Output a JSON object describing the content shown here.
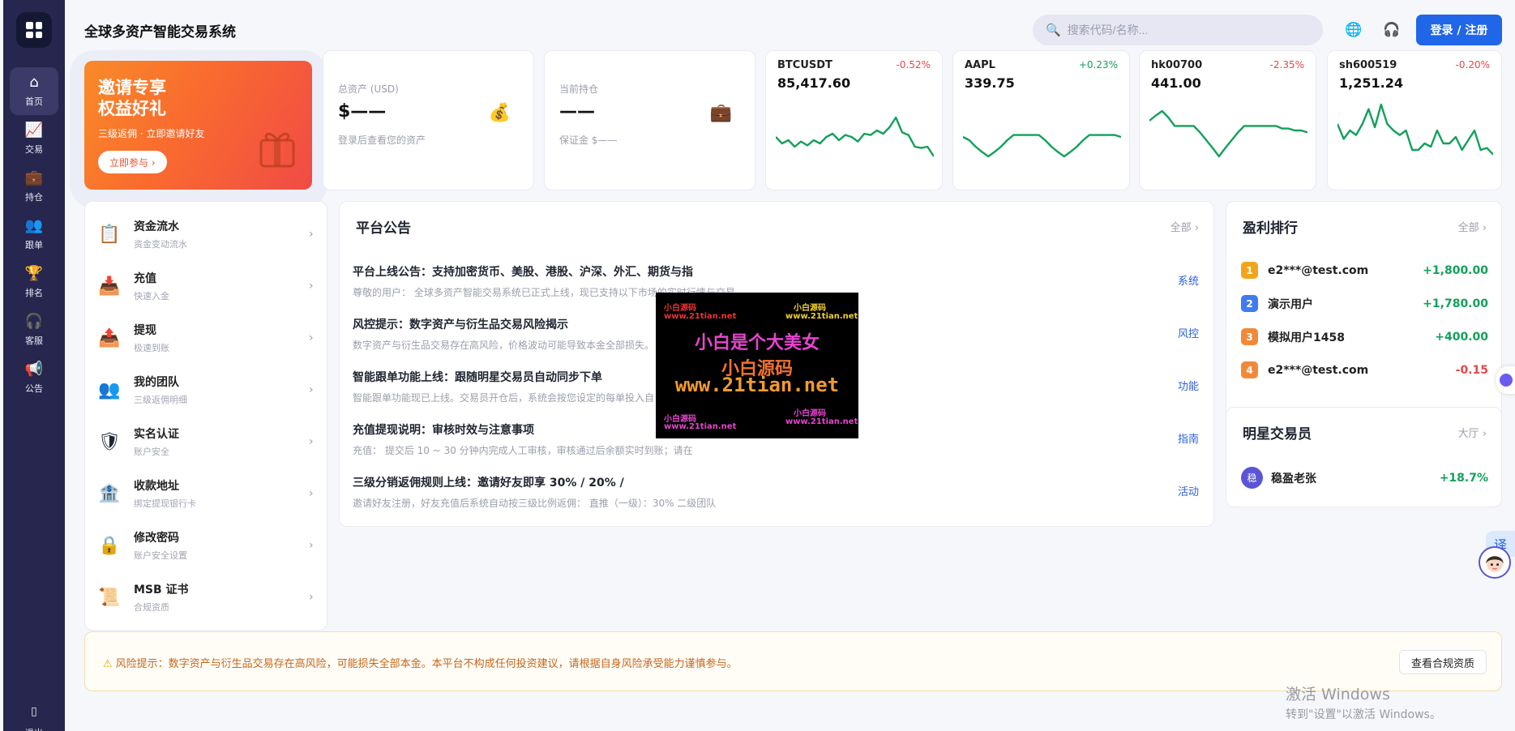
{
  "app": {
    "title": "全球多资产智能交易系统",
    "search_placeholder": "搜索代码/名称...",
    "login_label": "登录 / 注册"
  },
  "sidebar": {
    "items": [
      {
        "label": "首页",
        "icon": "home-icon",
        "glyph": "⌂",
        "active": true
      },
      {
        "label": "交易",
        "icon": "chart-icon",
        "glyph": "📈"
      },
      {
        "label": "持仓",
        "icon": "briefcase-icon",
        "glyph": "💼"
      },
      {
        "label": "跟单",
        "icon": "users-icon",
        "glyph": "👥"
      },
      {
        "label": "排名",
        "icon": "trophy-icon",
        "glyph": "🏆"
      },
      {
        "label": "客服",
        "icon": "headset-icon",
        "glyph": "🎧"
      },
      {
        "label": "公告",
        "icon": "megaphone-icon",
        "glyph": "📢"
      }
    ],
    "logout_label": "退出"
  },
  "promo": {
    "title": "邀请专享\n权益好礼",
    "subtitle": "三级返佣 · 立即邀请好友",
    "button_label": "立即参与 ›"
  },
  "stats": [
    {
      "label": "总资产 (USD)",
      "value": "$——",
      "hint": "登录后查看您的资产",
      "icon": "money-bag-icon",
      "glyph": "💰"
    },
    {
      "label": "当前持仓",
      "value": "——",
      "hint": "保证金 $——",
      "icon": "briefcase-icon",
      "glyph": "💼"
    }
  ],
  "tickers": [
    {
      "symbol": "BTCUSDT",
      "change": "-0.52%",
      "price": "85,417.60",
      "dir": "down",
      "spark": [
        0.35,
        0.25,
        0.3,
        0.2,
        0.28,
        0.22,
        0.3,
        0.25,
        0.35,
        0.4,
        0.3,
        0.38,
        0.35,
        0.28,
        0.4,
        0.38,
        0.45,
        0.4,
        0.5,
        0.65,
        0.42,
        0.38,
        0.2,
        0.18,
        0.2,
        0.05
      ]
    },
    {
      "symbol": "AAPL",
      "change": "+0.23%",
      "price": "339.75",
      "dir": "up",
      "spark": [
        0.35,
        0.3,
        0.2,
        0.12,
        0.05,
        0.12,
        0.2,
        0.3,
        0.38,
        0.38,
        0.38,
        0.38,
        0.38,
        0.3,
        0.2,
        0.12,
        0.05,
        0.12,
        0.2,
        0.3,
        0.38,
        0.38,
        0.38,
        0.38,
        0.38,
        0.35
      ]
    },
    {
      "symbol": "hk00700",
      "change": "-2.35%",
      "price": "441.00",
      "dir": "down",
      "spark": [
        0.6,
        0.68,
        0.75,
        0.65,
        0.52,
        0.52,
        0.52,
        0.52,
        0.42,
        0.3,
        0.18,
        0.05,
        0.18,
        0.3,
        0.42,
        0.52,
        0.52,
        0.52,
        0.52,
        0.52,
        0.52,
        0.48,
        0.48,
        0.45,
        0.45,
        0.42
      ]
    },
    {
      "symbol": "sh600519",
      "change": "-0.20%",
      "price": "1,251.24",
      "dir": "down",
      "spark": [
        0.55,
        0.32,
        0.45,
        0.38,
        0.55,
        0.78,
        0.5,
        0.85,
        0.55,
        0.45,
        0.38,
        0.45,
        0.15,
        0.15,
        0.25,
        0.2,
        0.45,
        0.25,
        0.25,
        0.35,
        0.15,
        0.3,
        0.45,
        0.15,
        0.18,
        0.08
      ]
    }
  ],
  "menu": [
    {
      "title": "资金流水",
      "subtitle": "资金变动流水",
      "icon": "ledger-icon",
      "glyph": "📋"
    },
    {
      "title": "充值",
      "subtitle": "快速入金",
      "icon": "deposit-icon",
      "glyph": "📥"
    },
    {
      "title": "提现",
      "subtitle": "极速到账",
      "icon": "withdraw-icon",
      "glyph": "📤"
    },
    {
      "title": "我的团队",
      "subtitle": "三级返佣明细",
      "icon": "team-icon",
      "glyph": "👥"
    },
    {
      "title": "实名认证",
      "subtitle": "账户安全",
      "icon": "shield-icon",
      "glyph": "🛡"
    },
    {
      "title": "收款地址",
      "subtitle": "绑定提现银行卡",
      "icon": "bank-icon",
      "glyph": "🏦"
    },
    {
      "title": "修改密码",
      "subtitle": "账户安全设置",
      "icon": "lock-icon",
      "glyph": "🔒"
    },
    {
      "title": "MSB 证书",
      "subtitle": "合规资质",
      "icon": "certificate-icon",
      "glyph": "📜"
    }
  ],
  "announcements": {
    "title": "平台公告",
    "all_label": "全部 ›",
    "items": [
      {
        "title": "平台上线公告：支持加密货币、美股、港股、沪深、外汇、期货与指",
        "desc": "尊敬的用户：  全球多资产智能交易系统已正式上线，现已支持以下市场的实时行情与交易",
        "tag": "系统"
      },
      {
        "title": "风控提示：数字资产与衍生品交易风险揭示",
        "desc": "数字资产与衍生品交易存在高风险，价格波动可能导致本金全部损失。",
        "tag": "风控"
      },
      {
        "title": "智能跟单功能上线：跟随明星交易员自动同步下单",
        "desc": "智能跟单功能现已上线。交易员开仓后，系统会按您设定的每单投入自",
        "tag": "功能"
      },
      {
        "title": "充值提现说明：审核时效与注意事项",
        "desc": "充值：  提交后 10 ~ 30 分钟内完成人工审核，审核通过后余额实时到账；请在",
        "tag": "指南"
      },
      {
        "title": "三级分销返佣规则上线：邀请好友即享 30% / 20% /",
        "desc": "邀请好友注册，好友充值后系统自动按三级比例返佣：  直推（一级）：30% 二级团队",
        "tag": "活动"
      }
    ]
  },
  "ranking": {
    "title": "盈利排行",
    "all_label": "全部 ›",
    "items": [
      {
        "rank": "1",
        "name": "e2***@test.com",
        "profit": "+1,800.00",
        "dir": "up",
        "color": "#f2a51c"
      },
      {
        "rank": "2",
        "name": "演示用户",
        "profit": "+1,780.00",
        "dir": "up",
        "color": "#3f7cf0"
      },
      {
        "rank": "3",
        "name": "模拟用户1458",
        "profit": "+400.00",
        "dir": "up",
        "color": "#f08a3a"
      },
      {
        "rank": "4",
        "name": "e2***@test.com",
        "profit": "-0.15",
        "dir": "down",
        "color": "#f08a3a"
      }
    ]
  },
  "star_traders": {
    "title": "明星交易员",
    "all_label": "大厅 ›",
    "items": [
      {
        "avatar": "稳",
        "name": "稳盈老张",
        "profit": "+18.7%"
      }
    ]
  },
  "watermark": {
    "small": [
      "小白源码",
      "小白源码",
      "www.21tian.net",
      "www.21tian.net",
      "小白源码",
      "小白源码",
      "www.21tian.net",
      "www.21tian.net"
    ],
    "line1": "小白是个大美女",
    "line2": "小白源码",
    "line3": "www.21tian.net"
  },
  "risk": {
    "text": "风险提示：数字资产与衍生品交易存在高风险，可能损失全部本金。本平台不构成任何投资建议，请根据自身风险承受能力谨慎参与。",
    "button_label": "查看合规资质"
  },
  "windows": {
    "line1": "激活 Windows",
    "line2": "转到\"设置\"以激活 Windows。"
  },
  "translate_label": "译",
  "colors": {
    "up": "#13a05b",
    "down": "#e34848",
    "accent": "#1f66e8",
    "rail": "#27264f"
  }
}
